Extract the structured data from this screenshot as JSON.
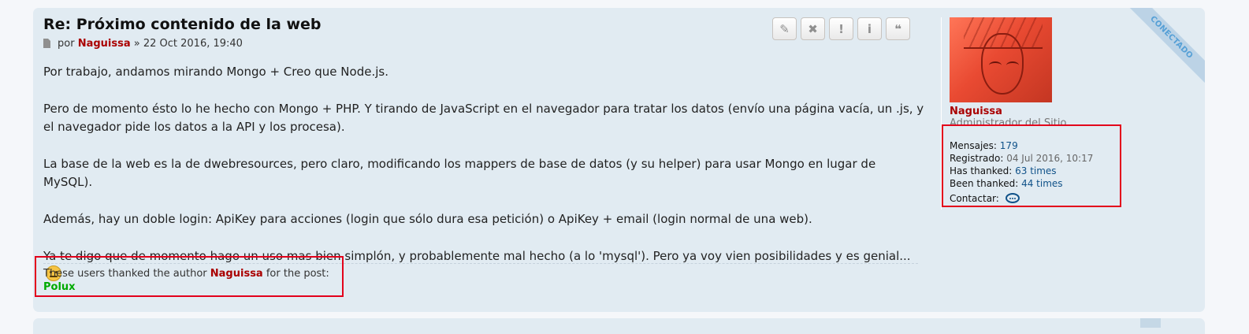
{
  "post": {
    "title": "Re: Próximo contenido de la web",
    "meta": {
      "by": "por",
      "author": "Naguissa",
      "date": "» 22 Oct 2016, 19:40"
    },
    "status_ribbon": "CONECTADO",
    "action_buttons": [
      {
        "name": "edit",
        "icon": "pencil-icon",
        "glyph": "✎"
      },
      {
        "name": "delete",
        "icon": "close-icon",
        "glyph": "✖"
      },
      {
        "name": "report",
        "icon": "exclamation-icon",
        "glyph": "!"
      },
      {
        "name": "info",
        "icon": "info-icon",
        "glyph": "i"
      },
      {
        "name": "quote",
        "icon": "quote-icon",
        "glyph": "❝"
      }
    ],
    "paragraphs": [
      "Por trabajo, andamos mirando Mongo + Creo que Node.js.",
      "Pero de momento ésto lo he hecho con Mongo + PHP. Y tirando de JavaScript en el navegador para tratar los datos (envío una página vacía, un .js, y el navegador pide los datos a la API y los procesa).",
      "La base de la web es la de dwebresources, pero claro, modificando los mappers de base de datos (y su helper) para usar Mongo en lugar de MySQL).",
      "Además, hay un doble login: ApiKey para acciones (login que sólo dura esa petición) o ApiKey + email (login normal de una web).",
      "Ya te digo que de momento hago un uso mas bien simplón, y probablemente mal hecho (a lo 'mysql'). Pero ya voy vien posibilidades y es genial..."
    ],
    "thanks": {
      "prefix": "These users thanked the author",
      "author": "Naguissa",
      "suffix": "for the post:",
      "users": [
        "Polux"
      ]
    }
  },
  "profile": {
    "username": "Naguissa",
    "rank": "Administrador del Sitio",
    "stats": {
      "mensajes_label": "Mensajes:",
      "mensajes_value": "179",
      "registrado_label": "Registrado:",
      "registrado_value": "04 Jul 2016, 10:17",
      "has_thanked_label": "Has thanked:",
      "has_thanked_value": "63 times",
      "been_thanked_label": "Been thanked:",
      "been_thanked_value": "44 times",
      "contactar_label": "Contactar:"
    }
  },
  "colors": {
    "post_bg": "#e1ebf2",
    "username": "#aa0000",
    "thanker": "#00aa00",
    "link": "#105289",
    "highlight": "#e3001b"
  }
}
